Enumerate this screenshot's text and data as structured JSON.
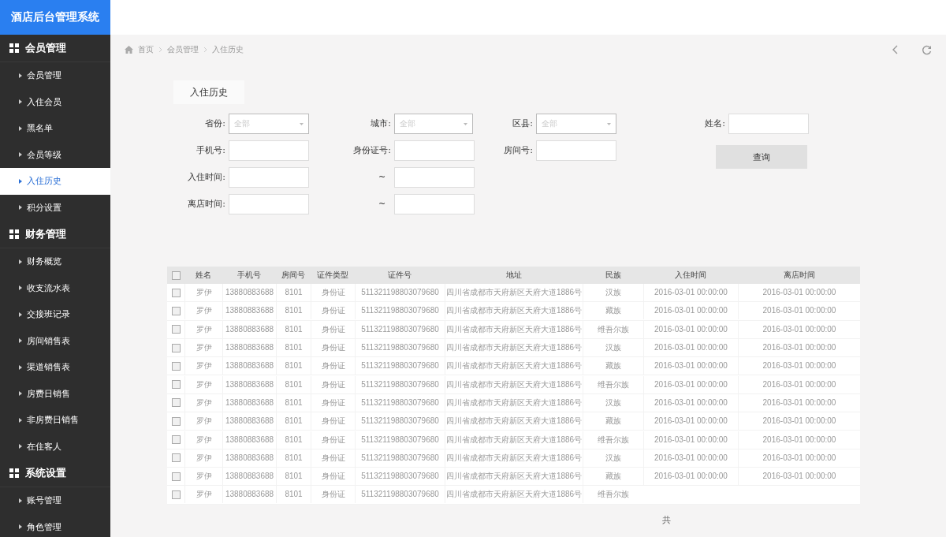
{
  "app_title": "酒店后台管理系统",
  "sidebar": [
    {
      "label": "会员管理",
      "children": [
        {
          "label": "会员管理",
          "selected": false
        },
        {
          "label": "入住会员",
          "selected": false
        },
        {
          "label": "黑名单",
          "selected": false
        },
        {
          "label": "会员等级",
          "selected": false
        },
        {
          "label": "入住历史",
          "selected": true
        },
        {
          "label": "积分设置",
          "selected": false
        }
      ]
    },
    {
      "label": "财务管理",
      "children": [
        {
          "label": "财务概览",
          "selected": false
        },
        {
          "label": "收支流水表",
          "selected": false
        },
        {
          "label": "交接班记录",
          "selected": false
        },
        {
          "label": "房间销售表",
          "selected": false
        },
        {
          "label": "渠道销售表",
          "selected": false
        },
        {
          "label": "房费日销售",
          "selected": false
        },
        {
          "label": "非房费日销售",
          "selected": false
        },
        {
          "label": "在住客人",
          "selected": false
        }
      ]
    },
    {
      "label": "系统设置",
      "children": [
        {
          "label": "账号管理",
          "selected": false
        },
        {
          "label": "角色管理",
          "selected": false
        }
      ]
    }
  ],
  "breadcrumb": [
    "首页",
    "会员管理",
    "入住历史"
  ],
  "panel_title": "入住历史",
  "filters": [
    [
      {
        "kind": "select",
        "label": "省份:",
        "placeholder": "全部"
      },
      {
        "kind": "select",
        "label": "城市:",
        "placeholder": "全部"
      },
      {
        "kind": "select",
        "label": "区县:",
        "placeholder": "全部"
      },
      {
        "kind": "input",
        "label": "姓名:"
      }
    ],
    [
      {
        "kind": "input",
        "label": "手机号:"
      },
      {
        "kind": "input",
        "label": "身份证号:"
      },
      {
        "kind": "input",
        "label": "房间号:"
      },
      {
        "kind": "button",
        "label": "查询"
      }
    ],
    [
      {
        "kind": "input",
        "label": "入住时间:"
      },
      {
        "kind": "input",
        "label": "~"
      }
    ],
    [
      {
        "kind": "input",
        "label": "离店时间:"
      },
      {
        "kind": "input",
        "label": "~"
      }
    ]
  ],
  "table": {
    "columns": [
      "姓名",
      "手机号",
      "房间号",
      "证件类型",
      "证件号",
      "地址",
      "民族",
      "入住时间",
      "离店时间"
    ],
    "all_checked": false,
    "rows": [
      {
        "checked": false,
        "cells": [
          "罗伊",
          "13880883688",
          "8101",
          "身份证",
          "511321198803079680",
          "四川省成都市天府新区天府大道1886号",
          "汉族",
          "2016-03-01 00:00:00",
          "2016-03-01 00:00:00"
        ]
      },
      {
        "checked": false,
        "cells": [
          "罗伊",
          "13880883688",
          "8101",
          "身份证",
          "511321198803079680",
          "四川省成都市天府新区天府大道1886号",
          "藏族",
          "2016-03-01 00:00:00",
          "2016-03-01 00:00:00"
        ]
      },
      {
        "checked": false,
        "cells": [
          "罗伊",
          "13880883688",
          "8101",
          "身份证",
          "511321198803079680",
          "四川省成都市天府新区天府大道1886号",
          "维吾尔族",
          "2016-03-01 00:00:00",
          "2016-03-01 00:00:00"
        ]
      },
      {
        "checked": false,
        "cells": [
          "罗伊",
          "13880883688",
          "8101",
          "身份证",
          "511321198803079680",
          "四川省成都市天府新区天府大道1886号",
          "汉族",
          "2016-03-01 00:00:00",
          "2016-03-01 00:00:00"
        ]
      },
      {
        "checked": false,
        "cells": [
          "罗伊",
          "13880883688",
          "8101",
          "身份证",
          "511321198803079680",
          "四川省成都市天府新区天府大道1886号",
          "藏族",
          "2016-03-01 00:00:00",
          "2016-03-01 00:00:00"
        ]
      },
      {
        "checked": false,
        "cells": [
          "罗伊",
          "13880883688",
          "8101",
          "身份证",
          "511321198803079680",
          "四川省成都市天府新区天府大道1886号",
          "维吾尔族",
          "2016-03-01 00:00:00",
          "2016-03-01 00:00:00"
        ]
      },
      {
        "checked": false,
        "cells": [
          "罗伊",
          "13880883688",
          "8101",
          "身份证",
          "511321198803079680",
          "四川省成都市天府新区天府大道1886号",
          "汉族",
          "2016-03-01 00:00:00",
          "2016-03-01 00:00:00"
        ]
      },
      {
        "checked": false,
        "cells": [
          "罗伊",
          "13880883688",
          "8101",
          "身份证",
          "511321198803079680",
          "四川省成都市天府新区天府大道1886号",
          "藏族",
          "2016-03-01 00:00:00",
          "2016-03-01 00:00:00"
        ]
      },
      {
        "checked": false,
        "cells": [
          "罗伊",
          "13880883688",
          "8101",
          "身份证",
          "511321198803079680",
          "四川省成都市天府新区天府大道1886号",
          "维吾尔族",
          "2016-03-01 00:00:00",
          "2016-03-01 00:00:00"
        ]
      },
      {
        "checked": false,
        "cells": [
          "罗伊",
          "13880883688",
          "8101",
          "身份证",
          "511321198803079680",
          "四川省成都市天府新区天府大道1886号",
          "汉族",
          "2016-03-01 00:00:00",
          "2016-03-01 00:00:00"
        ]
      },
      {
        "checked": false,
        "cells": [
          "罗伊",
          "13880883688",
          "8101",
          "身份证",
          "511321198803079680",
          "四川省成都市天府新区天府大道1886号",
          "藏族",
          "2016-03-01 00:00:00",
          "2016-03-01 00:00:00"
        ]
      },
      {
        "checked": false,
        "cells": [
          "罗伊",
          "13880883688",
          "8101",
          "身份证",
          "511321198803079680",
          "四川省成都市天府新区天府大道1886号",
          "维吾尔族"
        ]
      }
    ]
  },
  "footer_text": "共"
}
